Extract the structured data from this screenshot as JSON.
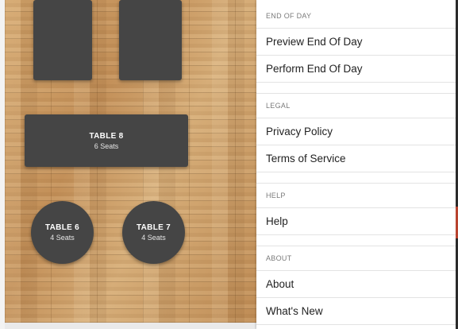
{
  "floor": {
    "tables": [
      {
        "id": "top-left",
        "name": "",
        "seats": ""
      },
      {
        "id": "top-right",
        "name": "",
        "seats": ""
      },
      {
        "id": "table-8",
        "name": "TABLE 8",
        "seats": "6 Seats"
      },
      {
        "id": "table-6",
        "name": "TABLE 6",
        "seats": "4 Seats"
      },
      {
        "id": "table-7",
        "name": "TABLE 7",
        "seats": "4 Seats"
      }
    ]
  },
  "menu": {
    "sections": [
      {
        "header": "END OF DAY",
        "items": [
          "Preview End Of Day",
          "Perform End Of Day"
        ]
      },
      {
        "header": "LEGAL",
        "items": [
          "Privacy Policy",
          "Terms of Service"
        ]
      },
      {
        "header": "HELP",
        "items": [
          "Help"
        ]
      },
      {
        "header": "ABOUT",
        "items": [
          "About",
          "What's New"
        ]
      }
    ]
  },
  "colors": {
    "table_fill": "#454545",
    "table_text": "#ffffff",
    "floor_wood": "#c99a62",
    "menu_header_text": "#7b7b7b",
    "menu_item_text": "#222222",
    "divider": "#e3e3e3"
  }
}
